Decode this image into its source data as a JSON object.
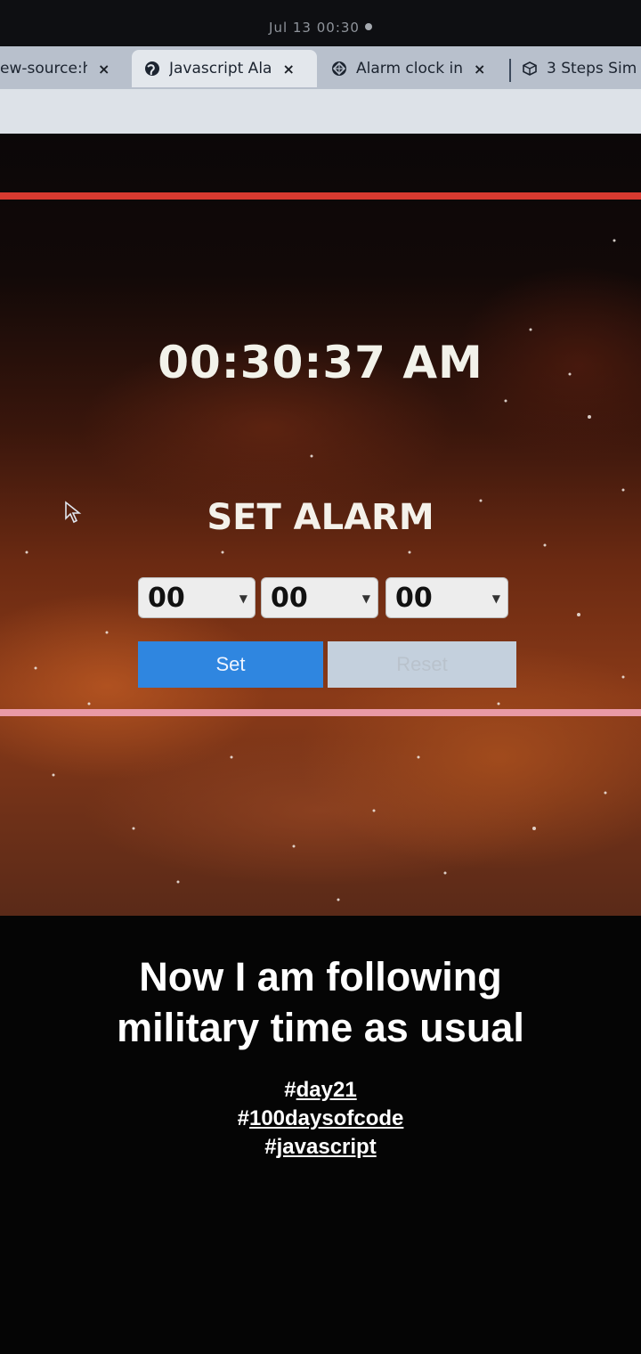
{
  "system_bar": {
    "datetime": "Jul 13  00:30"
  },
  "tabs": [
    {
      "label": "ew-source:h",
      "icon": "none",
      "active": false
    },
    {
      "label": "Javascript Ala",
      "icon": "globe-icon",
      "active": true
    },
    {
      "label": "Alarm clock in",
      "icon": "codepen-icon",
      "active": false
    },
    {
      "label": "3 Steps Sim",
      "icon": "cube-icon",
      "active": false
    }
  ],
  "tab_close": "×",
  "app": {
    "current_time": "00:30:37 AM",
    "heading": "SET ALARM",
    "selects": [
      {
        "value": "00"
      },
      {
        "value": "00"
      },
      {
        "value": "00"
      }
    ],
    "set_button": "Set",
    "reset_button": "Reset"
  },
  "colors": {
    "set_button": "#2f86e0",
    "reset_button": "#c4d0dd",
    "top_rule": "#d83a30",
    "bottom_rule": "#e99aa6"
  },
  "caption": {
    "line1": "Now I am following",
    "line2": "military time as usual"
  },
  "hashtags": [
    "day21",
    "100daysofcode",
    "javascript"
  ]
}
